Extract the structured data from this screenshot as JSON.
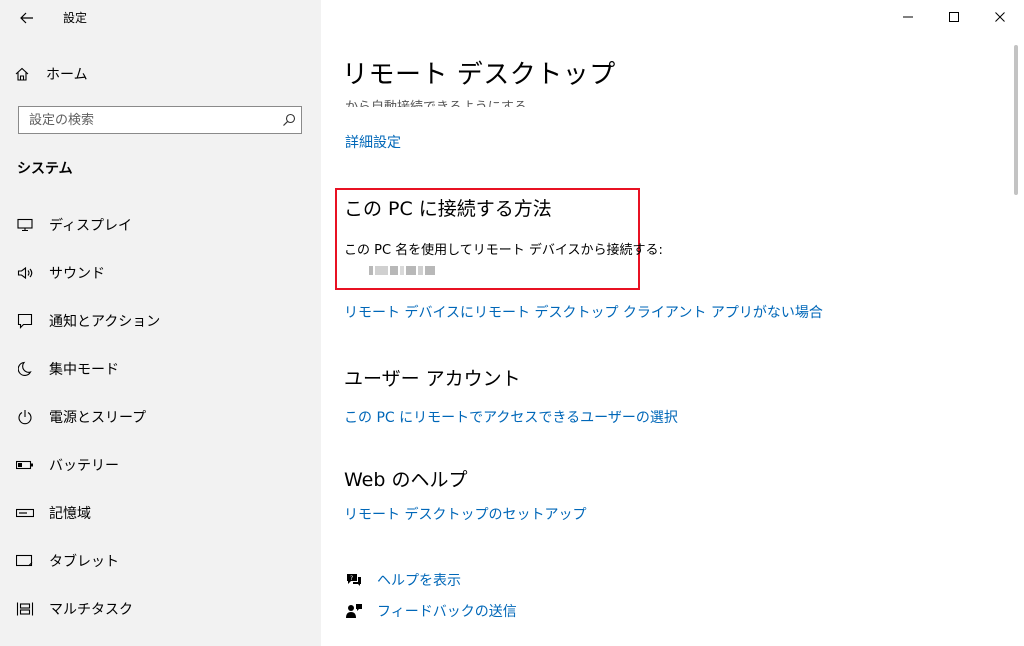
{
  "window": {
    "title": "設定",
    "controls": [
      "minimize",
      "maximize",
      "close"
    ]
  },
  "sidebar": {
    "home_label": "ホーム",
    "search_placeholder": "設定の検索",
    "section_title": "システム",
    "items": [
      {
        "label": "ディスプレイ",
        "icon": "display-icon"
      },
      {
        "label": "サウンド",
        "icon": "speaker-icon"
      },
      {
        "label": "通知とアクション",
        "icon": "notification-icon"
      },
      {
        "label": "集中モード",
        "icon": "moon-icon"
      },
      {
        "label": "電源とスリープ",
        "icon": "power-icon"
      },
      {
        "label": "バッテリー",
        "icon": "battery-icon"
      },
      {
        "label": "記憶域",
        "icon": "storage-icon"
      },
      {
        "label": "タブレット",
        "icon": "tablet-icon"
      },
      {
        "label": "マルチタスク",
        "icon": "multitask-icon"
      }
    ]
  },
  "main": {
    "page_title": "リモート デスクトップ",
    "cut_off_text": "から自動接続できるようにする",
    "advanced_link": "詳細設定",
    "connect_section": {
      "heading": "この PC に接続する方法",
      "description": "この PC 名を使用してリモート デバイスから接続する:"
    },
    "no_client_link": "リモート デバイスにリモート デスクトップ クライアント アプリがない場合",
    "user_accounts": {
      "heading": "ユーザー アカウント",
      "link": "この PC にリモートでアクセスできるユーザーの選択"
    },
    "web_help": {
      "heading": "Web のヘルプ",
      "link": "リモート デスクトップのセットアップ"
    },
    "help_links": {
      "get_help": "ヘルプを表示",
      "feedback": "フィードバックの送信"
    }
  },
  "colors": {
    "link": "#0067b8",
    "highlight_border": "#e81123",
    "sidebar_bg": "#f2f2f2"
  }
}
